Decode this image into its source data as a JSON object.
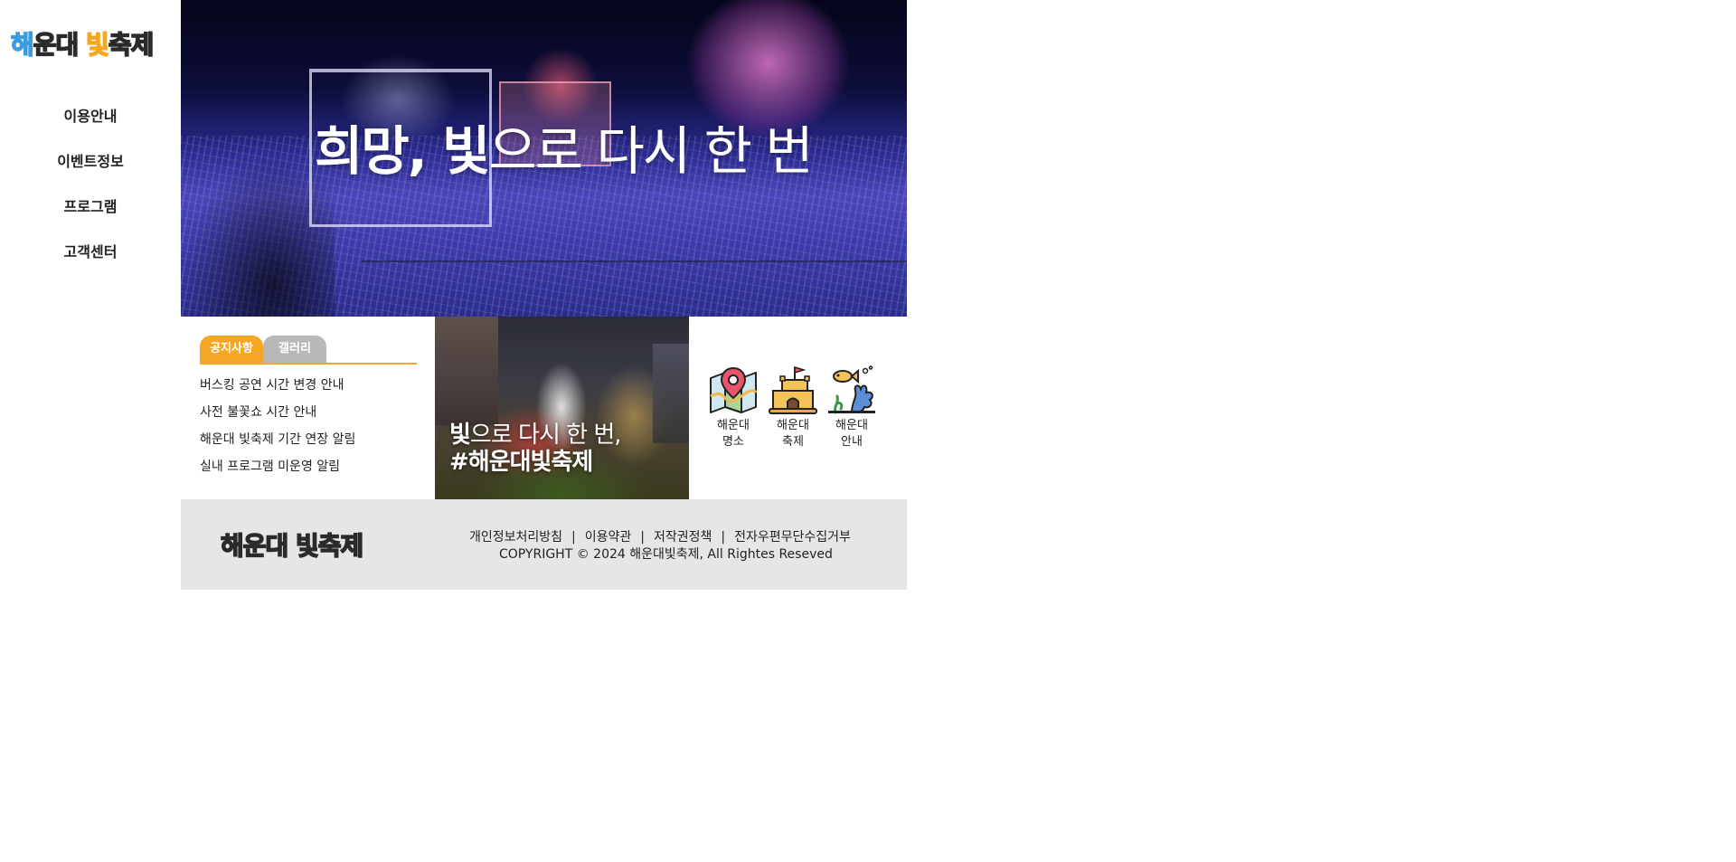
{
  "brand": {
    "logo_part1": "해",
    "logo_part2": "운대 ",
    "logo_part3": "빛",
    "logo_part4": "축제",
    "colors": {
      "blue": "#3d9be0",
      "orange": "#f5a623",
      "dark": "#2a2a2a"
    }
  },
  "nav": {
    "items": [
      {
        "label": "이용안내"
      },
      {
        "label": "이벤트정보"
      },
      {
        "label": "프로그램"
      },
      {
        "label": "고객센터"
      }
    ]
  },
  "hero": {
    "title_bold": "희망, 빛",
    "title_rest": "으로 다시 한 번"
  },
  "notice": {
    "tabs": [
      {
        "label": "공지사항",
        "active": true
      },
      {
        "label": "갤러리",
        "active": false
      }
    ],
    "items": [
      {
        "title": "버스킹 공연 시간 변경 안내"
      },
      {
        "title": "사전 불꽃쇼 시간 안내"
      },
      {
        "title": "해운대 빛축제 기간 연장 알림"
      },
      {
        "title": "실내 프로그램 미운영 알림"
      }
    ]
  },
  "promo": {
    "line1_bold": "빛",
    "line1_rest": "으로 다시 한 번,",
    "line2": "#해운대빛축제"
  },
  "quick_menu": {
    "items": [
      {
        "line1": "해운대",
        "line2": "명소",
        "icon": "map-pin-icon"
      },
      {
        "line1": "해운대",
        "line2": "축제",
        "icon": "sandcastle-icon"
      },
      {
        "line1": "해운대",
        "line2": "안내",
        "icon": "fish-coral-icon"
      }
    ]
  },
  "footer": {
    "logo": "해운대 빛축제",
    "links": [
      {
        "label": "개인정보처리방침"
      },
      {
        "label": "이용약관"
      },
      {
        "label": "저작권정책"
      },
      {
        "label": "전자우편무단수집거부"
      }
    ],
    "separator": "|",
    "copyright": "COPYRIGHT © 2024 해운대빛축제, All Rightes Reseved"
  }
}
